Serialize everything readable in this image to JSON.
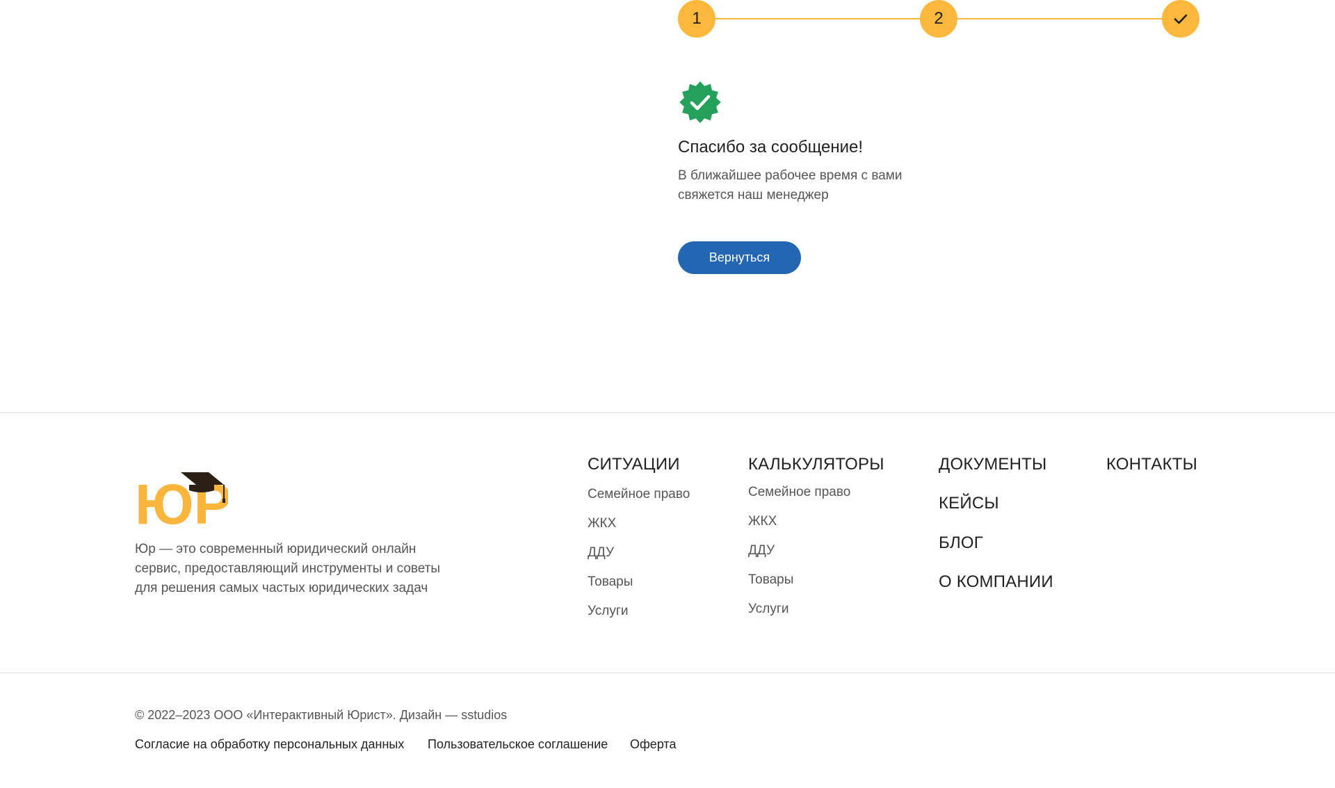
{
  "stepper": {
    "steps": [
      {
        "label": "1",
        "state": "done"
      },
      {
        "label": "2",
        "state": "done"
      },
      {
        "label": "",
        "state": "complete",
        "icon": "checkmark-icon"
      }
    ],
    "accent_color": "#fbb83d"
  },
  "success": {
    "icon": "verified-badge-icon",
    "badge_color": "#23a15a",
    "title": "Спасибо за сообщение!",
    "text_line1": "В ближайшее рабочее время с вами",
    "text_line2": "свяжется наш менеджер",
    "back_button": "Вернуться",
    "button_color": "#2367b2"
  },
  "footer": {
    "logo_text": "ЮР",
    "about_line1": "Юр — это современный юридический онлайн",
    "about_line2": "сервис, предоставляющий инструменты и советы",
    "about_line3": "для решения самых частых юридических задач",
    "situations": {
      "title": "СИТУАЦИИ",
      "links": [
        "Семейное право",
        "ЖКХ",
        "ДДУ",
        "Товары",
        "Услуги"
      ]
    },
    "calculators": {
      "title": "КАЛЬКУЛЯТОРЫ",
      "links": [
        "Семейное право",
        "ЖКХ",
        "ДДУ",
        "Товары",
        "Услуги"
      ]
    },
    "sections": [
      "ДОКУМЕНТЫ",
      "КЕЙСЫ",
      "БЛОГ",
      "О КОМПАНИИ"
    ],
    "contacts": "КОНТАКТЫ",
    "copyright": "© 2022–2023 ООО «Интерактивный Юрист». Дизайн — sstudios",
    "legal": [
      "Согласие на обработку персональных данных",
      "Пользовательское соглашение",
      "Оферта"
    ]
  }
}
